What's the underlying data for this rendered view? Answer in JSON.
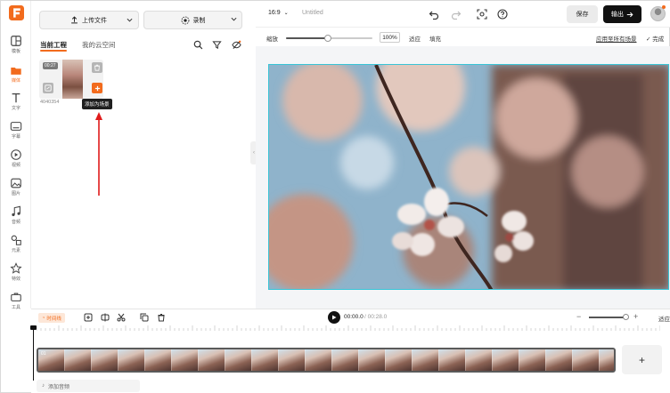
{
  "colors": {
    "accent": "#f26b1d",
    "canvas_border": "#39c4d6",
    "dark": "#111111"
  },
  "rail": {
    "items": [
      {
        "label": "模板",
        "icon": "template-icon"
      },
      {
        "label": "媒体",
        "icon": "media-folder-icon",
        "active": true
      },
      {
        "label": "文字",
        "icon": "text-icon"
      },
      {
        "label": "字幕",
        "icon": "subtitle-icon"
      },
      {
        "label": "视频",
        "icon": "video-icon"
      },
      {
        "label": "图片",
        "icon": "image-icon"
      },
      {
        "label": "音频",
        "icon": "music-icon"
      },
      {
        "label": "元素",
        "icon": "elements-icon"
      },
      {
        "label": "特效",
        "icon": "effects-icon"
      },
      {
        "label": "工具",
        "icon": "toolbox-icon"
      }
    ]
  },
  "panel": {
    "upload_label": "上传文件",
    "record_label": "录制",
    "tabs": [
      "当前工程",
      "我的云空间"
    ],
    "asset": {
      "duration": "00:27",
      "name": "4040354"
    },
    "tooltip": "添加为场景"
  },
  "topbar": {
    "ratio": "16:9",
    "title": "Untitled",
    "save": "保存",
    "export": "输出"
  },
  "zoombar": {
    "zoom_label": "缩放",
    "zoom_value": "100%",
    "zoom_fraction": 0.48,
    "fit": "适应",
    "fill": "填充",
    "apply_all": "应用至所有场景",
    "done": "完成"
  },
  "timeline": {
    "badge": "时间线",
    "current_time": "00:00.0",
    "total_time": "/ 00:28.0",
    "fit": "适应",
    "clip_label": "01",
    "add_audio": "添加音频"
  }
}
